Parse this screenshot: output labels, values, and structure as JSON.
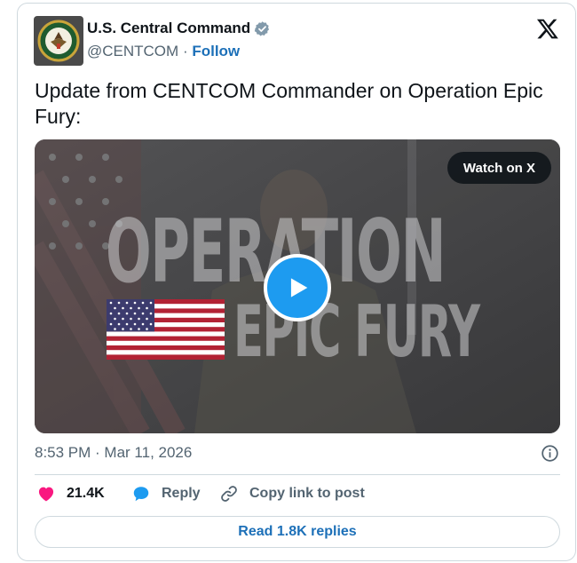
{
  "author": {
    "name": "U.S. Central Command",
    "handle": "@CENTCOM",
    "separator": "·",
    "follow_label": "Follow",
    "verified_color": "#829aab"
  },
  "icons": {
    "platform": "x-logo-icon",
    "verified": "verified-badge-icon",
    "info": "info-icon",
    "like": "heart-icon",
    "reply": "reply-bubble-icon",
    "copy": "link-icon",
    "play": "play-icon"
  },
  "post": {
    "text": "Update from CENTCOM Commander on Operation Epic Fury:",
    "timestamp": "8:53 PM · Mar 11, 2026"
  },
  "media": {
    "watch_label": "Watch on X",
    "overlay_line1": "OPERATION",
    "overlay_line2": "EPIC FURY",
    "play_color": "#1d9bf0"
  },
  "actions": {
    "like_count": "21.4K",
    "like_color": "#f91880",
    "reply_label": "Reply",
    "reply_color": "#1d9bf0",
    "copy_label": "Copy link to post"
  },
  "footer": {
    "read_replies_label": "Read 1.8K replies"
  }
}
